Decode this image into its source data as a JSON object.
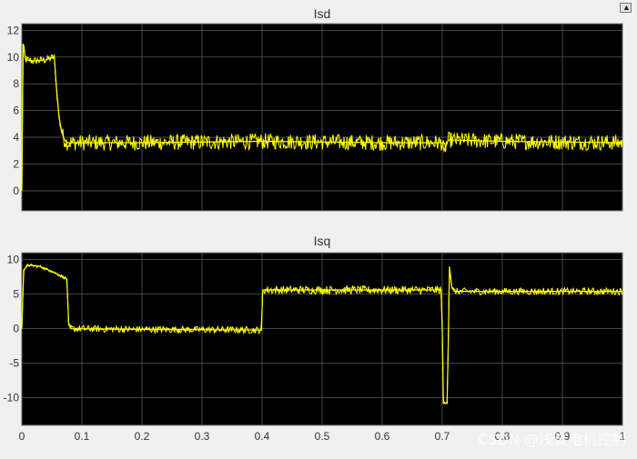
{
  "watermark": "CSDN @浅谈电机控制",
  "colors": {
    "plot_bg": "#000000",
    "figure_bg": "#f0f0f0",
    "grid": "#5a5a5a",
    "line": "#ffff00",
    "axis_text": "#333333"
  },
  "chart_data": [
    {
      "type": "line",
      "title": "Isd",
      "xlabel": "",
      "ylabel": "",
      "xlim": [
        0,
        1
      ],
      "ylim": [
        -1.5,
        12.5
      ],
      "xticks": [
        0,
        0.1,
        0.2,
        0.3,
        0.4,
        0.5,
        0.6,
        0.7,
        0.8,
        0.9,
        1
      ],
      "xtick_labels": [
        "",
        "",
        "",
        "",
        "",
        "",
        "",
        "",
        "",
        "",
        ""
      ],
      "yticks": [
        0,
        2,
        4,
        6,
        8,
        10,
        12
      ],
      "ytick_labels": [
        "0",
        "2",
        "4",
        "6",
        "8",
        "10",
        "12"
      ],
      "grid": true,
      "series": [
        {
          "color": "#ffff00",
          "x": [
            0,
            0.002,
            0.006,
            0.02,
            0.04,
            0.054,
            0.058,
            0.062,
            0.066,
            0.07,
            0.075,
            0.08,
            0.2,
            0.4,
            0.402,
            0.6,
            0.7,
            0.703,
            0.71,
            0.8,
            1
          ],
          "y": [
            0,
            11,
            9.8,
            9.7,
            9.8,
            10,
            7.5,
            5.5,
            4.5,
            3.9,
            3.6,
            3.6,
            3.6,
            3.7,
            3.7,
            3.6,
            3.6,
            3.0,
            3.8,
            3.7,
            3.6
          ],
          "noise": [
            0,
            0.3,
            0.3,
            0.3,
            0.3,
            0.3,
            0.4,
            0.4,
            0.5,
            0.6,
            0.6,
            0.6,
            0.6,
            0.6,
            0.6,
            0.6,
            0.6,
            0.6,
            0.6,
            0.6,
            0.6
          ]
        }
      ]
    },
    {
      "type": "line",
      "title": "Isq",
      "xlabel": "",
      "ylabel": "",
      "xlim": [
        0,
        1
      ],
      "ylim": [
        -14,
        11
      ],
      "xticks": [
        0,
        0.1,
        0.2,
        0.3,
        0.4,
        0.5,
        0.6,
        0.7,
        0.8,
        0.9,
        1
      ],
      "xtick_labels": [
        "0",
        "0.1",
        "0.2",
        "0.3",
        "0.4",
        "0.5",
        "0.6",
        "0.7",
        "0.8",
        "0.9",
        "1"
      ],
      "yticks": [
        -10,
        -5,
        0,
        5,
        10
      ],
      "ytick_labels": [
        "-10",
        "-5",
        "0",
        "5",
        "10"
      ],
      "grid": true,
      "series": [
        {
          "color": "#ffff00",
          "x": [
            0,
            0.003,
            0.01,
            0.03,
            0.05,
            0.075,
            0.078,
            0.082,
            0.2,
            0.399,
            0.401,
            0.5,
            0.698,
            0.7,
            0.702,
            0.705,
            0.708,
            0.71,
            0.712,
            0.716,
            0.72,
            0.8,
            1
          ],
          "y": [
            0,
            8.5,
            9.2,
            9.0,
            8.3,
            7.2,
            0.5,
            0.0,
            -0.1,
            -0.2,
            5.6,
            5.6,
            5.6,
            0,
            -10.8,
            -10.8,
            -10.8,
            -2,
            9,
            6,
            5.4,
            5.4,
            5.4
          ],
          "noise": [
            0,
            0.2,
            0.2,
            0.2,
            0.2,
            0.2,
            0.3,
            0.5,
            0.5,
            0.5,
            0.6,
            0.6,
            0.6,
            0,
            0.2,
            0.2,
            0.2,
            0,
            0,
            0.3,
            0.5,
            0.5,
            0.5
          ]
        }
      ]
    }
  ]
}
